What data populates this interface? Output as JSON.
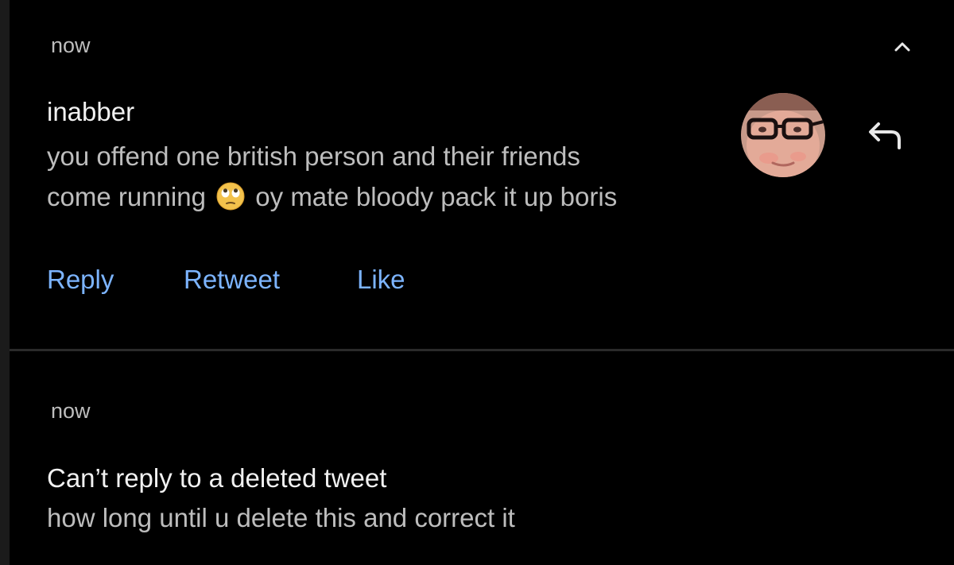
{
  "notifications": [
    {
      "timestamp": "now",
      "sender": "inabber",
      "message_line1": "you offend one british person and their friends",
      "message_line2_before": "come running",
      "message_emoji": "face-with-rolling-eyes",
      "message_line2_after": "oy mate bloody pack it up boris",
      "actions": {
        "reply": "Reply",
        "retweet": "Retweet",
        "like": "Like"
      },
      "icons": {
        "collapse": "chevron-up-icon",
        "reply": "reply-arrow-icon"
      },
      "colors": {
        "action_link": "#7cb4ff",
        "background": "#000000",
        "primary_text": "#f1f1f1",
        "secondary_text": "#bdbdbd"
      }
    },
    {
      "timestamp": "now",
      "title": "Can’t reply to a deleted tweet",
      "body": "how long until u delete this and correct it"
    }
  ]
}
